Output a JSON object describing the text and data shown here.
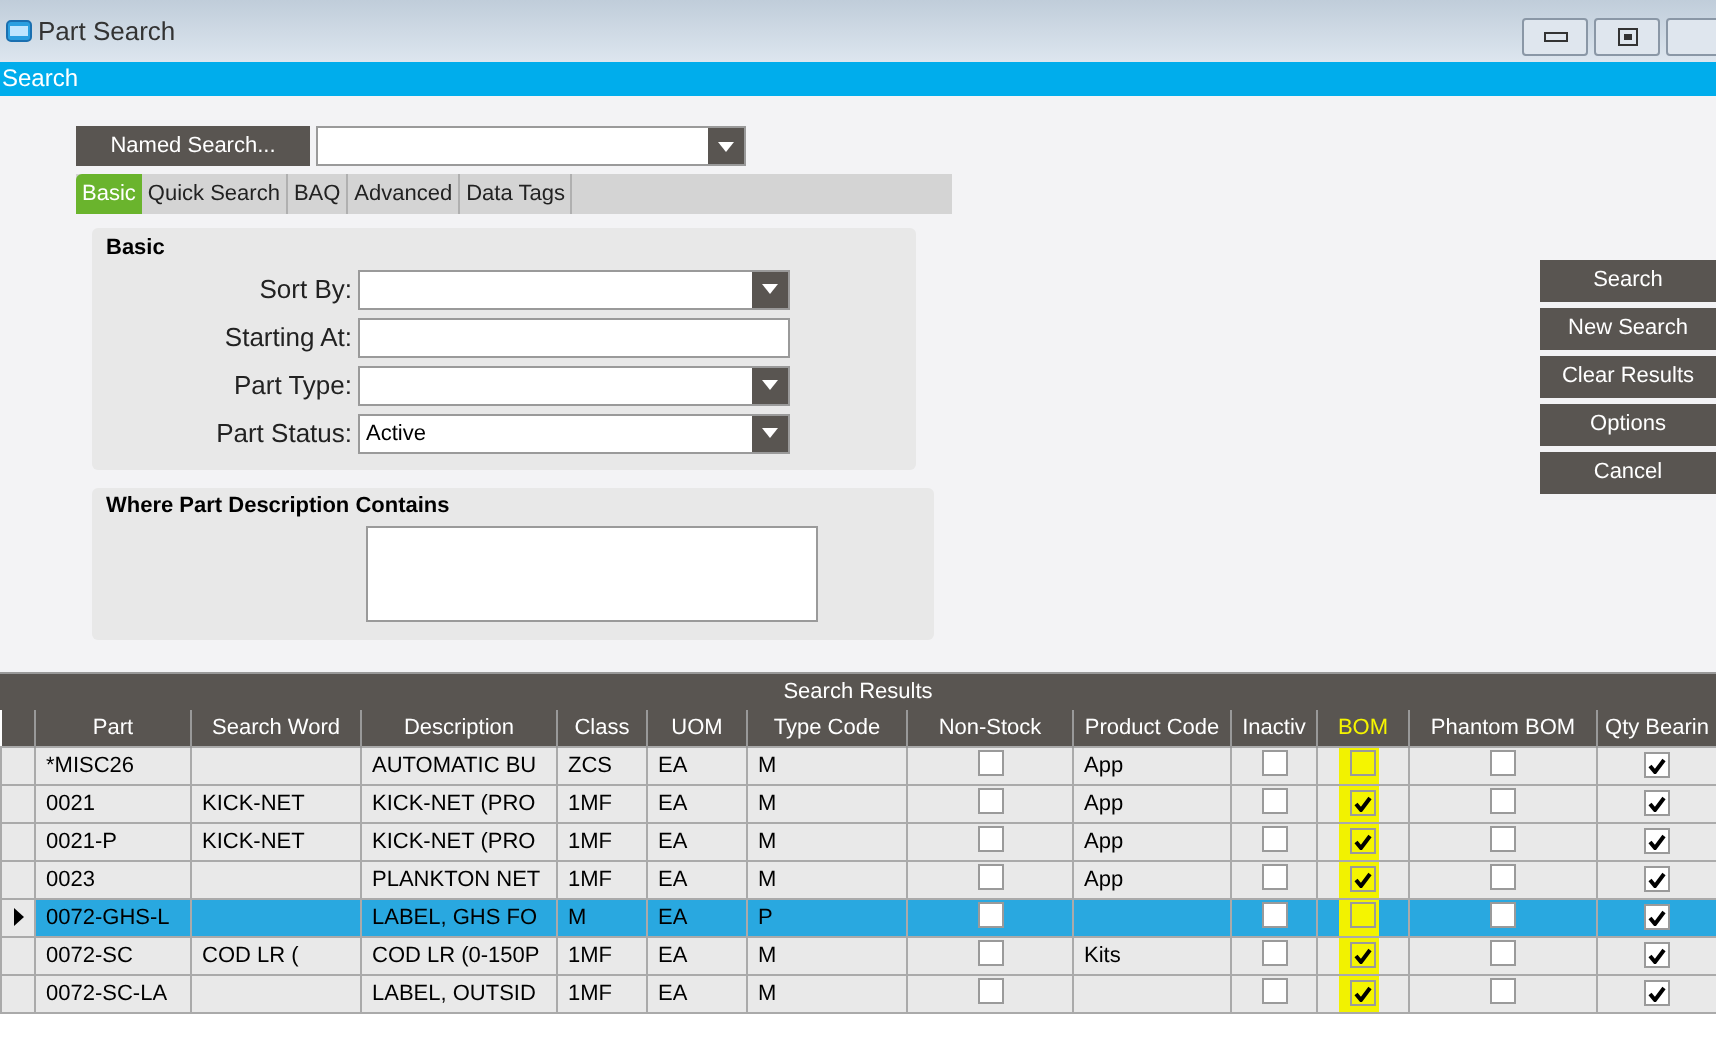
{
  "window": {
    "title": "Part Search"
  },
  "header_bar": {
    "title": "Search"
  },
  "named_search": {
    "button": "Named Search..."
  },
  "tabs": [
    {
      "label": "Basic",
      "selected": true
    },
    {
      "label": "Quick Search",
      "selected": false
    },
    {
      "label": "BAQ",
      "selected": false
    },
    {
      "label": "Advanced",
      "selected": false
    },
    {
      "label": "Data Tags",
      "selected": false
    }
  ],
  "basic_group": {
    "title": "Basic",
    "fields": [
      {
        "label": "Sort By:",
        "kind": "dropdown"
      },
      {
        "label": "Starting At:",
        "kind": "text"
      },
      {
        "label": "Part Type:",
        "kind": "dropdown"
      },
      {
        "label": "Part Status:",
        "kind": "dropdown",
        "value": "Active"
      }
    ]
  },
  "description_group": {
    "title": "Where Part Description Contains"
  },
  "actions": [
    "Search",
    "New Search",
    "Clear Results",
    "Options",
    "Cancel"
  ],
  "results": {
    "title": "Search Results",
    "columns": [
      "Part",
      "Search Word",
      "Description",
      "Class",
      "UOM",
      "Type Code",
      "Non-Stock",
      "Product Code",
      "Inactiv",
      "BOM",
      "Phantom BOM",
      "Qty Bearin"
    ],
    "rows": [
      {
        "part": "*MISC26",
        "description": "AUTOMATIC BU",
        "class": "ZCS",
        "uom": "EA",
        "type_code": "M",
        "non_stock": false,
        "product_code": "App",
        "inactive": false,
        "bom": false,
        "phantom_bom": false,
        "qty_bearing": true,
        "selected": false
      },
      {
        "part": "0021",
        "search_word": "KICK-NET",
        "description": "KICK-NET (PRO",
        "class": "1MF",
        "uom": "EA",
        "type_code": "M",
        "non_stock": false,
        "product_code": "App",
        "inactive": false,
        "bom": true,
        "phantom_bom": false,
        "qty_bearing": true,
        "selected": false
      },
      {
        "part": "0021-P",
        "search_word": "KICK-NET",
        "description": "KICK-NET (PRO",
        "class": "1MF",
        "uom": "EA",
        "type_code": "M",
        "non_stock": false,
        "product_code": "App",
        "inactive": false,
        "bom": true,
        "phantom_bom": false,
        "qty_bearing": true,
        "selected": false
      },
      {
        "part": "0023",
        "description": "PLANKTON NET",
        "class": "1MF",
        "uom": "EA",
        "type_code": "M",
        "non_stock": false,
        "product_code": "App",
        "inactive": false,
        "bom": true,
        "phantom_bom": false,
        "qty_bearing": true,
        "selected": false
      },
      {
        "part": "0072-GHS-L",
        "description": "LABEL, GHS FO",
        "class": "M",
        "uom": "EA",
        "type_code": "P",
        "non_stock": false,
        "inactive": false,
        "bom": false,
        "phantom_bom": false,
        "qty_bearing": true,
        "selected": true
      },
      {
        "part": "0072-SC",
        "search_word": "COD LR (",
        "description": "COD LR (0-150P",
        "class": "1MF",
        "uom": "EA",
        "type_code": "M",
        "non_stock": false,
        "product_code": "Kits",
        "inactive": false,
        "bom": true,
        "phantom_bom": false,
        "qty_bearing": true,
        "selected": false
      },
      {
        "part": "0072-SC-LA",
        "description": "LABEL, OUTSID",
        "class": "1MF",
        "uom": "EA",
        "type_code": "M",
        "non_stock": false,
        "inactive": false,
        "bom": true,
        "phantom_bom": false,
        "qty_bearing": true,
        "selected": false
      }
    ]
  }
}
